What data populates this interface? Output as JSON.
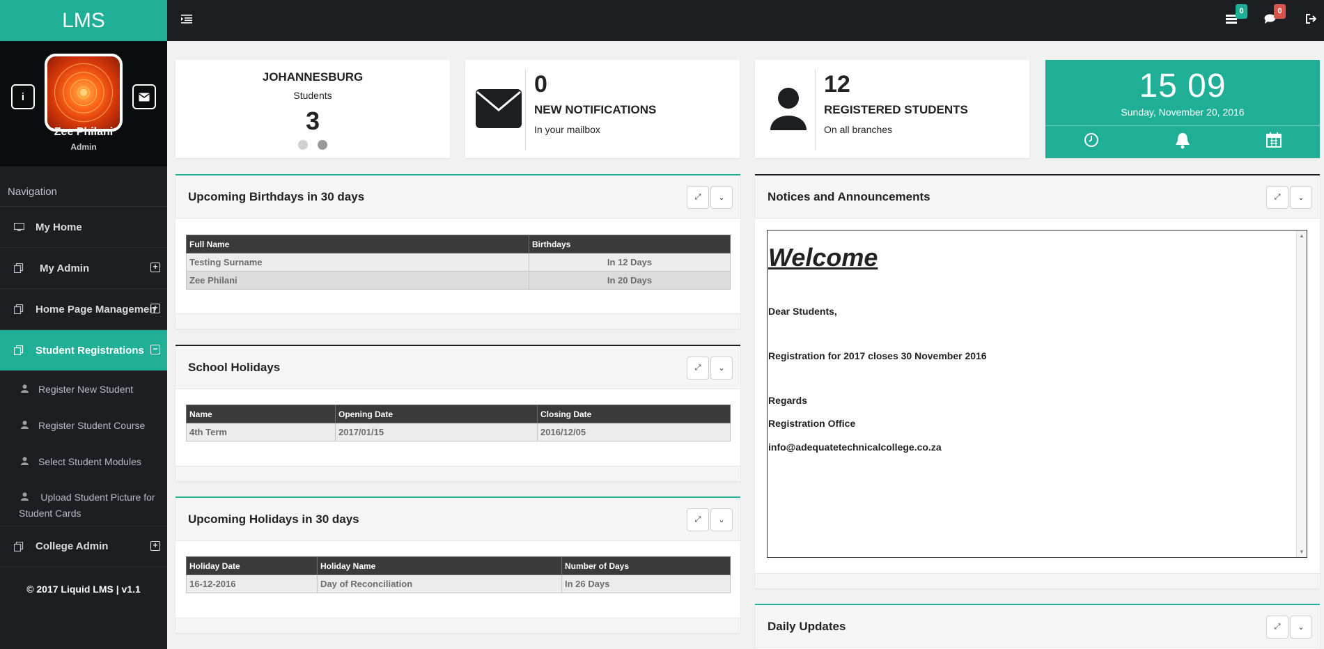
{
  "app": {
    "logo": "LMS"
  },
  "profile": {
    "name": "Zee Philani",
    "role": "Admin"
  },
  "nav": {
    "heading": "Navigation",
    "items": [
      {
        "label": "My Home",
        "icon": "monitor-icon"
      },
      {
        "label": "My Admin",
        "icon": "copy-icon"
      },
      {
        "label": "Home Page Management",
        "icon": "copy-icon"
      },
      {
        "label": "Student Registrations",
        "icon": "copy-icon"
      },
      {
        "label": "College Admin",
        "icon": "copy-icon"
      }
    ],
    "sub_items": [
      "Register New Student",
      "Register Student Course",
      "Select Student Modules",
      "Upload Student Picture for Student Cards"
    ],
    "footer": "© 2017 Liquid LMS | v1.1"
  },
  "topbar": {
    "tasks_badge": "0",
    "messages_badge": "0",
    "colors": {
      "tasks": "#1fae96",
      "messages": "#d9534f"
    }
  },
  "stats": {
    "branch": {
      "name": "JOHANNESBURG",
      "label": "Students",
      "value": "3"
    },
    "notifications": {
      "value": "0",
      "title": "NEW NOTIFICATIONS",
      "subtitle": "In your mailbox"
    },
    "students": {
      "value": "12",
      "title": "REGISTERED STUDENTS",
      "subtitle": "On all branches"
    },
    "clock": {
      "time": "15 09",
      "date": "Sunday, November 20, 2016"
    }
  },
  "birthdays": {
    "title": "Upcoming Birthdays in 30 days",
    "headers": [
      "Full Name",
      "Birthdays"
    ],
    "rows": [
      [
        "Testing Surname",
        "In 12 Days"
      ],
      [
        "Zee Philani",
        "In 20 Days"
      ]
    ]
  },
  "school_holidays": {
    "title": "School Holidays",
    "headers": [
      "Name",
      "Opening Date",
      "Closing Date"
    ],
    "rows": [
      [
        "4th Term",
        "2017/01/15",
        "2016/12/05"
      ]
    ]
  },
  "upcoming_holidays": {
    "title": "Upcoming Holidays in 30 days",
    "headers": [
      "Holiday Date",
      "Holiday Name",
      "Number of Days"
    ],
    "rows": [
      [
        "16-12-2016",
        "Day of Reconciliation",
        "In 26 Days"
      ]
    ]
  },
  "notices": {
    "title": "Notices and Announcements",
    "welcome": "Welcome",
    "lines": [
      "Dear Students,",
      "Registration for 2017 closes 30 November 2016",
      "Regards",
      "Registration Office",
      "info@adequatetechnicalcollege.co.za"
    ]
  },
  "daily_updates": {
    "title": "Daily Updates"
  },
  "accent": "#1fae96"
}
